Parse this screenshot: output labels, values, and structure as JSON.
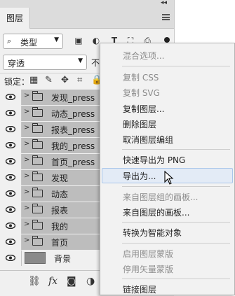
{
  "panel": {
    "tab_label": "图层",
    "filter_kind": "类型",
    "blend_mode": "穿透",
    "opacity_label": "不",
    "lock_label": "锁定："
  },
  "layers": [
    {
      "name": "发现_press",
      "type": "group",
      "selected": true
    },
    {
      "name": "动态_press",
      "type": "group",
      "selected": true
    },
    {
      "name": "报表_press",
      "type": "group",
      "selected": true
    },
    {
      "name": "我的_press",
      "type": "group",
      "selected": true
    },
    {
      "name": "首页_press",
      "type": "group",
      "selected": true
    },
    {
      "name": "发现",
      "type": "group",
      "selected": true
    },
    {
      "name": "动态",
      "type": "group",
      "selected": true
    },
    {
      "name": "报表",
      "type": "group",
      "selected": true
    },
    {
      "name": "我的",
      "type": "group",
      "selected": true
    },
    {
      "name": "首页",
      "type": "group",
      "selected": true
    },
    {
      "name": "背景",
      "type": "pixel",
      "selected": false
    }
  ],
  "context_menu": {
    "items": [
      {
        "label": "混合选项...",
        "enabled": false
      },
      {
        "label": "复制 CSS",
        "enabled": false
      },
      {
        "label": "复制 SVG",
        "enabled": false
      },
      {
        "label": "复制图层...",
        "enabled": true
      },
      {
        "label": "删除图层",
        "enabled": true
      },
      {
        "label": "取消图层编组",
        "enabled": true
      },
      {
        "label": "快速导出为 PNG",
        "enabled": true
      },
      {
        "label": "导出为...",
        "enabled": true,
        "highlighted": true
      },
      {
        "label": "来自图层组的画板...",
        "enabled": false
      },
      {
        "label": "来自图层的画板...",
        "enabled": true
      },
      {
        "label": "转换为智能对象",
        "enabled": true
      },
      {
        "label": "启用图层蒙版",
        "enabled": false
      },
      {
        "label": "停用矢量蒙版",
        "enabled": false
      },
      {
        "label": "链接图层",
        "enabled": true
      }
    ]
  },
  "colors": {
    "selected_layer_bg": "#bdbdbd",
    "menu_highlight": "#e3ebf6",
    "panel_bg": "#f0f0f0"
  }
}
